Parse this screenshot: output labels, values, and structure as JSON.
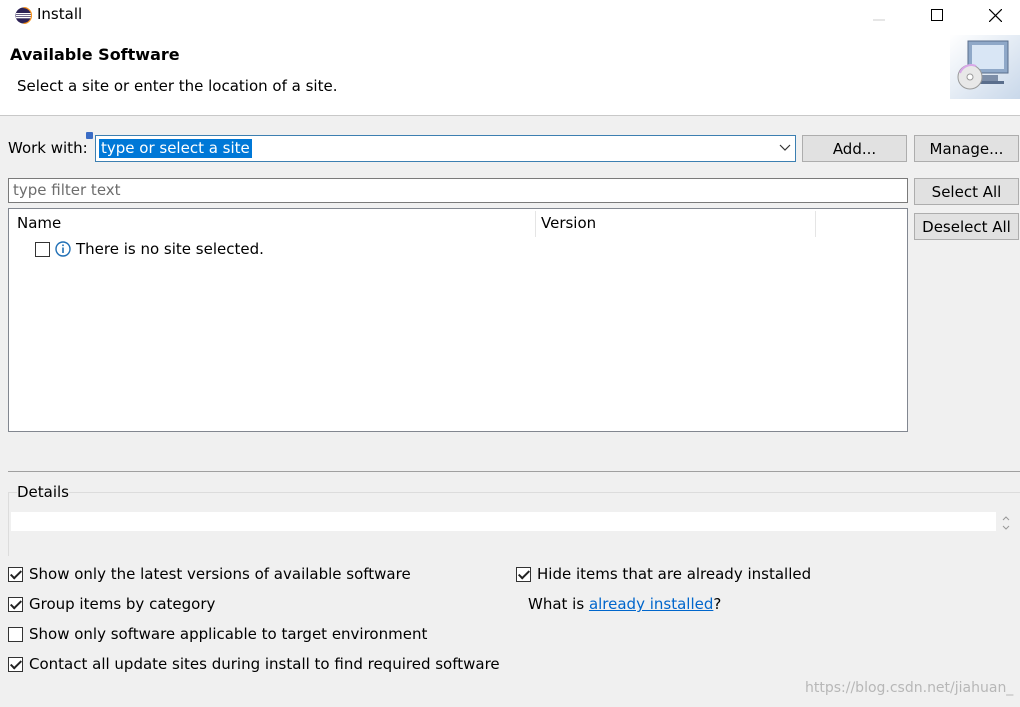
{
  "window": {
    "title": "Install"
  },
  "header": {
    "title": "Available Software",
    "description": "Select a site or enter the location of a site."
  },
  "work_with": {
    "label": "Work with:",
    "value": "type or select a site",
    "add_label": "Add...",
    "manage_label": "Manage..."
  },
  "filter": {
    "placeholder": "type filter text"
  },
  "actions": {
    "select_all": "Select All",
    "deselect_all": "Deselect All"
  },
  "tree": {
    "columns": [
      "Name",
      "Version"
    ],
    "rows": [
      {
        "text": "There is no site selected.",
        "checked": false
      }
    ]
  },
  "details": {
    "label": "Details"
  },
  "options": {
    "latest_versions": {
      "label": "Show only the latest versions of available software",
      "checked": true
    },
    "group_by_category": {
      "label": "Group items by category",
      "checked": true
    },
    "target_env": {
      "label": "Show only software applicable to target environment",
      "checked": false
    },
    "contact_sites": {
      "label": "Contact all update sites during install to find required software",
      "checked": true
    },
    "hide_installed": {
      "label": "Hide items that are already installed",
      "checked": true
    },
    "what_is_prefix": "What is ",
    "already_installed_link": "already installed",
    "what_is_suffix": "?"
  },
  "watermark": "https://blog.csdn.net/jiahuan_",
  "colors": {
    "accent": "#0078d7",
    "link": "#0066cc"
  }
}
